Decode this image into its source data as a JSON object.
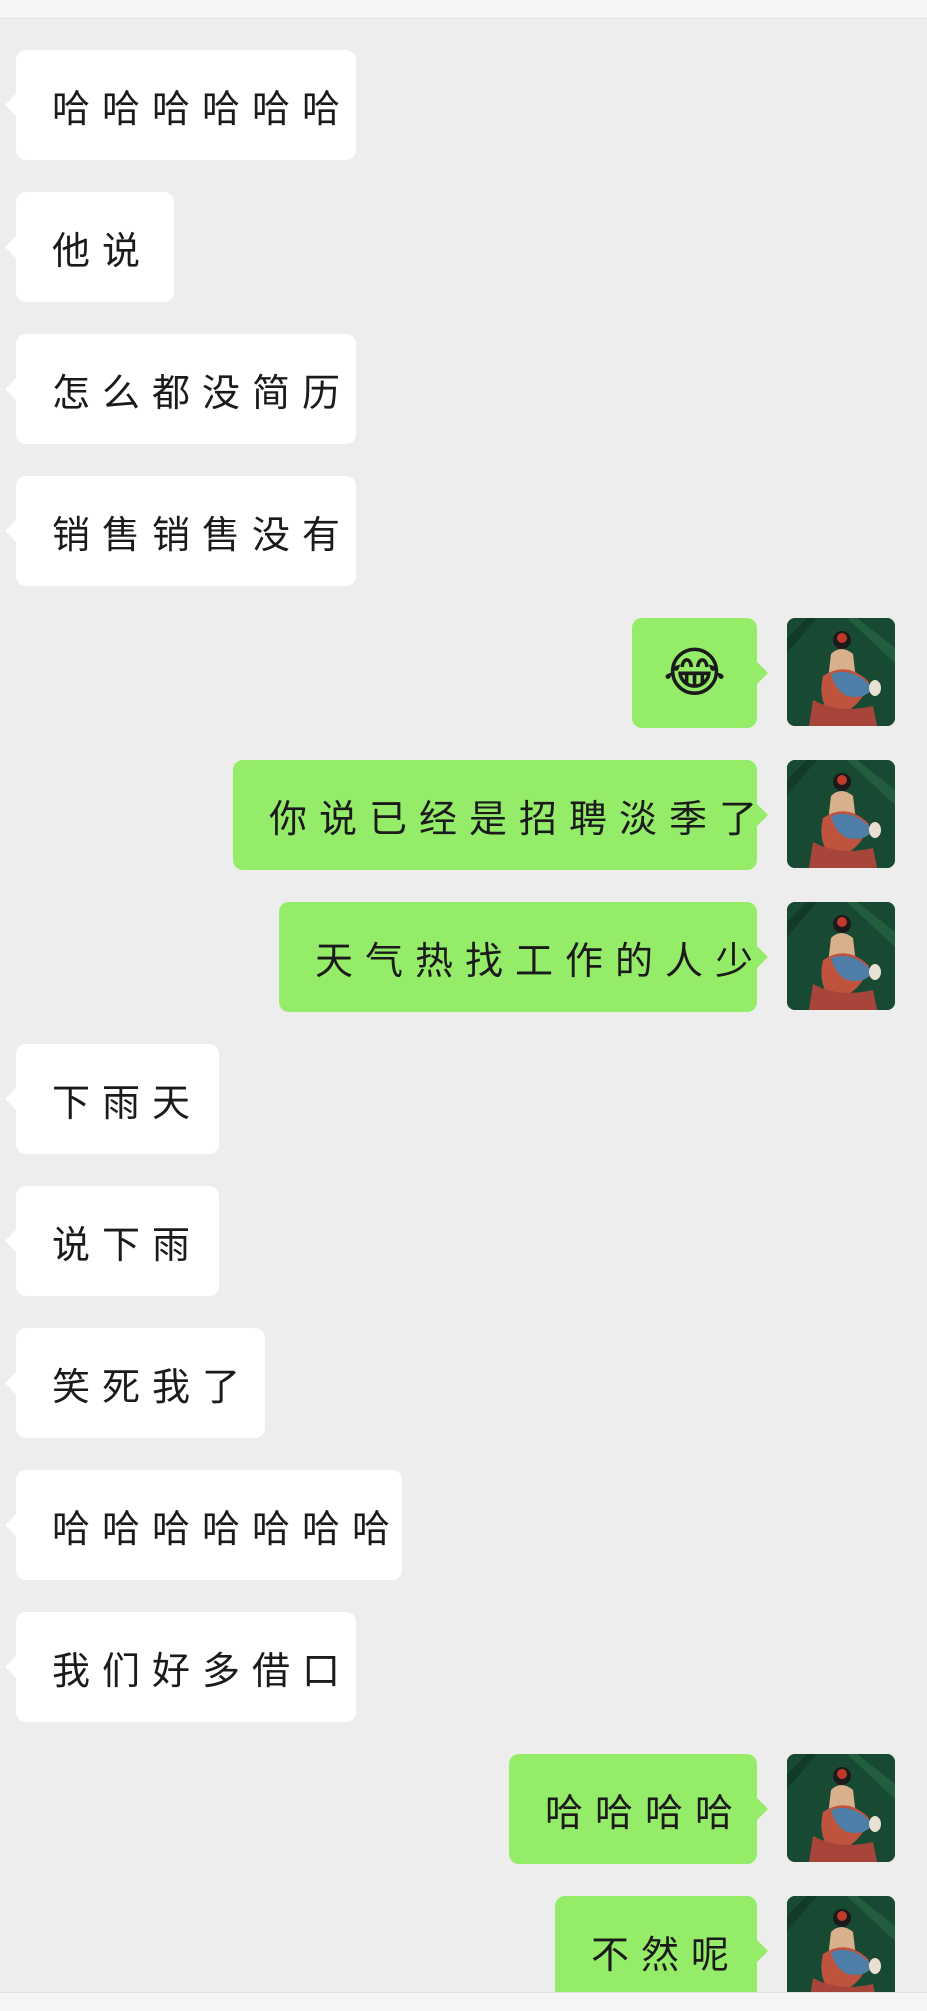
{
  "chat": {
    "messages": [
      {
        "from": "other",
        "text": "哈哈哈哈哈哈"
      },
      {
        "from": "other",
        "text": "他说"
      },
      {
        "from": "other",
        "text": "怎么都没简历"
      },
      {
        "from": "other",
        "text": "销售销售没有"
      },
      {
        "from": "me",
        "emoji": "😂"
      },
      {
        "from": "me",
        "text": "你说已经是招聘淡季了"
      },
      {
        "from": "me",
        "text": "天气热找工作的人少"
      },
      {
        "from": "other",
        "text": "下雨天"
      },
      {
        "from": "other",
        "text": "说下雨"
      },
      {
        "from": "other",
        "text": "笑死我了"
      },
      {
        "from": "other",
        "text": "哈哈哈哈哈哈哈"
      },
      {
        "from": "other",
        "text": "我们好多借口"
      },
      {
        "from": "me",
        "text": "哈哈哈哈"
      },
      {
        "from": "me",
        "text": "不然呢"
      }
    ]
  },
  "colors": {
    "background": "#ededed",
    "incoming_bubble": "#ffffff",
    "outgoing_bubble": "#95ec69"
  },
  "icons": {
    "avatar": "avatar-icon",
    "emoji": "face-with-tears-of-joy-icon"
  }
}
